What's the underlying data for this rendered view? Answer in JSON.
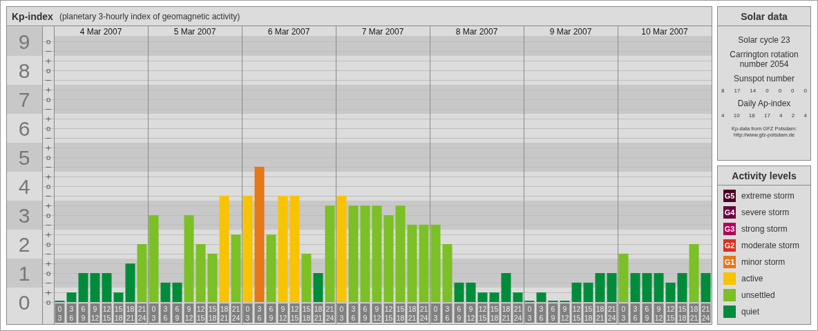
{
  "chart_panel": {
    "title": "Kp-index",
    "subtitle": "(planetary 3-hourly index of geomagnetic activity)",
    "day_labels": [
      "4 Mar 2007",
      "5 Mar 2007",
      "6 Mar 2007",
      "7 Mar 2007",
      "8 Mar 2007",
      "9 Mar 2007",
      "10 Mar 2007"
    ],
    "minor_ticks": [
      "o",
      "−",
      "+",
      "o",
      "−",
      "+",
      "o",
      "−",
      "+",
      "o",
      "−",
      "+",
      "o",
      "−",
      "+",
      "o",
      "−",
      "+",
      "o",
      "−",
      "+",
      "o",
      "−",
      "+",
      "o",
      "−",
      "+",
      "o"
    ],
    "chart_data": {
      "type": "bar",
      "grid": true,
      "categories": [
        "0 3",
        "3 6",
        "6 9",
        "9 12",
        "12 15",
        "15 18",
        "18 21",
        "21 24",
        "0 3",
        "3 6",
        "6 9",
        "9 12",
        "12 15",
        "15 18",
        "18 21",
        "21 24",
        "0 3",
        "3 6",
        "6 9",
        "9 12",
        "12 15",
        "15 18",
        "18 21",
        "21 24",
        "0 3",
        "3 6",
        "6 9",
        "9 12",
        "12 15",
        "15 18",
        "18 21",
        "21 24",
        "0 3",
        "3 6",
        "6 9",
        "9 12",
        "12 15",
        "15 18",
        "18 21",
        "21 24",
        "0 3",
        "3 6",
        "6 9",
        "9 12",
        "12 15",
        "15 18",
        "18 21",
        "21 24",
        "0 3",
        "3 6",
        "6 9",
        "9 12",
        "12 15",
        "15 18",
        "18 21",
        "21 24"
      ],
      "series": [
        {
          "color": "#008c3a",
          "values": [
            0,
            0.33,
            1,
            1,
            1,
            0.33,
            1.33,
            null,
            null,
            0.67,
            0.67,
            null,
            null,
            null,
            null,
            null,
            null,
            null,
            null,
            null,
            null,
            null,
            1,
            null,
            null,
            null,
            null,
            null,
            null,
            null,
            null,
            null,
            null,
            null,
            0.67,
            0.67,
            0.33,
            0.33,
            1,
            0.33,
            0,
            0.33,
            0,
            0,
            0.67,
            0.67,
            1,
            1,
            null,
            1,
            1,
            1,
            0.67,
            1,
            null,
            1
          ]
        },
        {
          "color": "#7bc024",
          "values": [
            null,
            null,
            null,
            null,
            null,
            null,
            null,
            2,
            3,
            null,
            null,
            3,
            2,
            1.67,
            null,
            2.33,
            null,
            null,
            2.33,
            null,
            null,
            1.67,
            null,
            3.33,
            null,
            3.33,
            3.33,
            3.33,
            3,
            3.33,
            2.67,
            2.67,
            2.67,
            2,
            null,
            null,
            null,
            null,
            null,
            null,
            null,
            null,
            null,
            null,
            null,
            null,
            null,
            null,
            1.67,
            null,
            null,
            null,
            null,
            null,
            2,
            null
          ]
        },
        {
          "color": "#f8c300",
          "values": [
            null,
            null,
            null,
            null,
            null,
            null,
            null,
            null,
            null,
            null,
            null,
            null,
            null,
            null,
            3.67,
            null,
            3.67,
            null,
            null,
            3.67,
            3.67,
            null,
            null,
            null,
            3.67,
            null,
            null,
            null,
            null,
            null,
            null,
            null,
            null,
            null,
            null,
            null,
            null,
            null,
            null,
            null,
            null,
            null,
            null,
            null,
            null,
            null,
            null,
            null,
            null,
            null,
            null,
            null,
            null,
            null,
            null,
            null
          ]
        },
        {
          "color": "#e57716",
          "values": [
            null,
            null,
            null,
            null,
            null,
            null,
            null,
            null,
            null,
            null,
            null,
            null,
            null,
            null,
            null,
            null,
            null,
            4.67,
            null,
            null,
            null,
            null,
            null,
            null,
            null,
            null,
            null,
            null,
            null,
            null,
            null,
            null,
            null,
            null,
            null,
            null,
            null,
            null,
            null,
            null,
            null,
            null,
            null,
            null,
            null,
            null,
            null,
            null,
            null,
            null,
            null,
            null,
            null,
            null,
            null,
            null
          ]
        }
      ],
      "ylim": [
        0,
        9
      ],
      "yticks": [
        0,
        1,
        2,
        3,
        4,
        5,
        6,
        7,
        8,
        9
      ]
    }
  },
  "solar_data": {
    "title": "Solar data",
    "solar_cycle": "Solar cycle 23",
    "carrington": "Carrington rotation number 2054",
    "sunspot_label": "Sunspot number",
    "sunspot_numbers": [
      "8",
      "17",
      "14",
      "0",
      "0",
      "0",
      "0"
    ],
    "ap_label": "Daily Ap-index",
    "ap_values": [
      "4",
      "10",
      "18",
      "17",
      "4",
      "2",
      "4"
    ],
    "source_lines": [
      "Kp-data from GFZ Potsdam:",
      "http://www.gfz-potsdam.de"
    ]
  },
  "activity_levels": {
    "title": "Activity levels",
    "levels": [
      {
        "code": "G5",
        "label": "extreme storm",
        "color": "#4a0026"
      },
      {
        "code": "G4",
        "label": "severe storm",
        "color": "#6b0040"
      },
      {
        "code": "G3",
        "label": "strong storm",
        "color": "#b0005a"
      },
      {
        "code": "G2",
        "label": "moderate storm",
        "color": "#d83020"
      },
      {
        "code": "G1",
        "label": "minor storm",
        "color": "#e57716"
      },
      {
        "label": "active",
        "color": "#f8c300"
      },
      {
        "label": "unsettled",
        "color": "#7bc024"
      },
      {
        "label": "quiet",
        "color": "#008c3a"
      }
    ]
  }
}
